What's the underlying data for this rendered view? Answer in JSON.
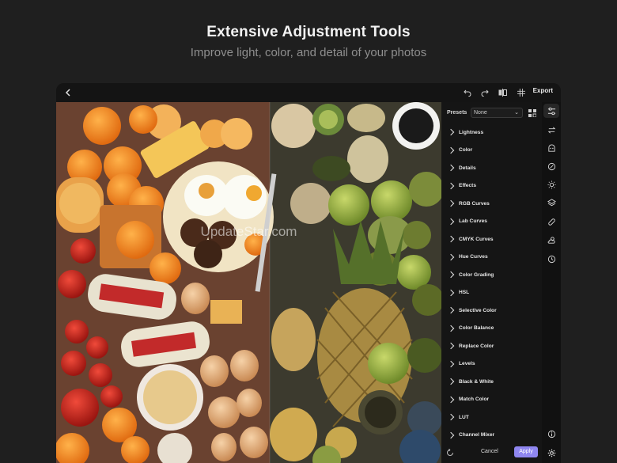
{
  "hero": {
    "title": "Extensive Adjustment Tools",
    "subtitle": "Improve light, color, and detail of your photos"
  },
  "toolbar": {
    "back_icon": "chevron-left-icon",
    "undo_icon": "undo-icon",
    "redo_icon": "redo-icon",
    "compare_icon": "compare-icon",
    "grid_icon": "grid-icon",
    "export_label": "Export"
  },
  "photo": {
    "watermark": "UpdateStar.com",
    "accent_orange": "#f0821e",
    "accent_green": "#8aa24a"
  },
  "presets": {
    "label": "Presets",
    "selected": "None"
  },
  "sections": [
    {
      "label": "Lightness"
    },
    {
      "label": "Color"
    },
    {
      "label": "Details"
    },
    {
      "label": "Effects"
    },
    {
      "label": "RGB Curves"
    },
    {
      "label": "Lab Curves"
    },
    {
      "label": "CMYK Curves"
    },
    {
      "label": "Hue Curves"
    },
    {
      "label": "Color Grading"
    },
    {
      "label": "HSL"
    },
    {
      "label": "Selective Color"
    },
    {
      "label": "Color Balance"
    },
    {
      "label": "Replace Color"
    },
    {
      "label": "Levels"
    },
    {
      "label": "Black & White"
    },
    {
      "label": "Match Color"
    },
    {
      "label": "LUT"
    },
    {
      "label": "Channel Mixer"
    }
  ],
  "footer": {
    "cancel_label": "Cancel",
    "apply_label": "Apply",
    "apply_color": "#8f86f0"
  },
  "rail_icons": [
    "sliders-icon",
    "transform-icon",
    "mask-icon",
    "retouch-icon",
    "light-icon",
    "layers-icon",
    "bandage-icon",
    "weather-icon",
    "history-icon",
    "info-icon",
    "settings-icon"
  ]
}
